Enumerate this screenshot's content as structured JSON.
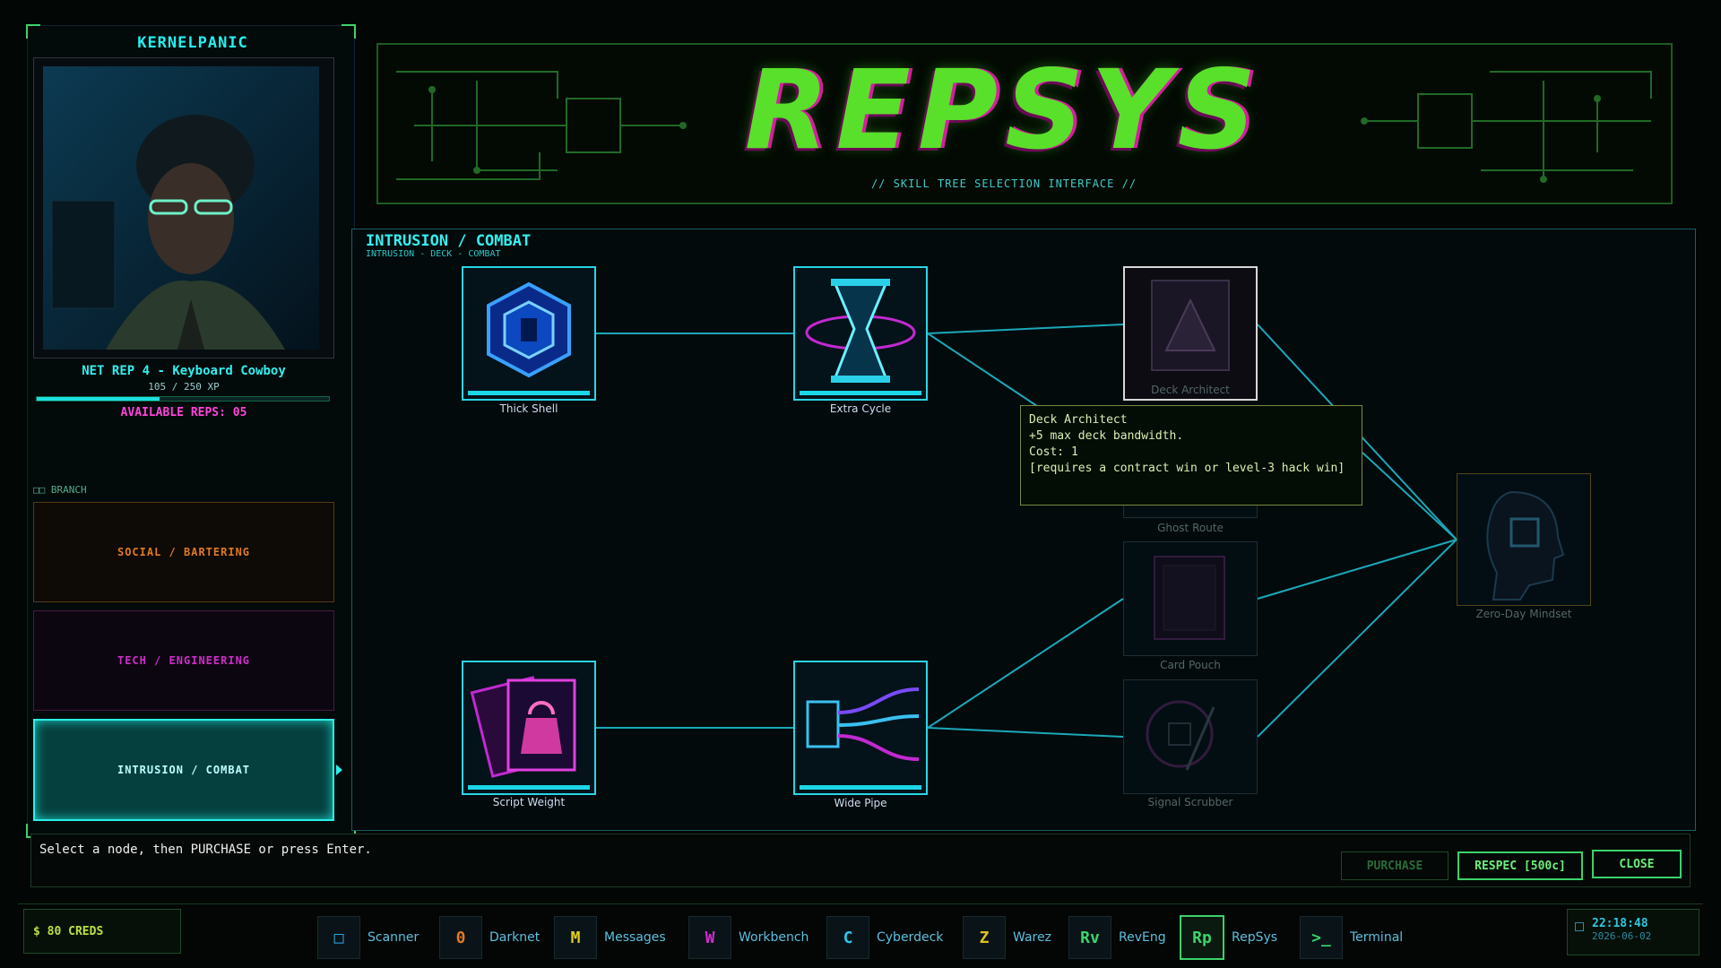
{
  "player": {
    "name": "KERNELPANIC",
    "rank": "NET REP 4 - Keyboard Cowboy",
    "xp": "105 / 250 XP",
    "xp_fraction": 0.42,
    "available_reps": "AVAILABLE REPS: 05"
  },
  "branches": {
    "label": "BRANCH",
    "items": [
      "SOCIAL / BARTERING",
      "TECH / ENGINEERING",
      "INTRUSION / COMBAT"
    ],
    "active": "INTRUSION / COMBAT"
  },
  "header": {
    "logo": "REPSYS",
    "subtitle": "//  SKILL TREE SELECTION INTERFACE  //"
  },
  "tree": {
    "title": "INTRUSION / COMBAT",
    "breadcrumb": "INTRUSION - DECK - COMBAT",
    "nodes": {
      "thick_shell": "Thick Shell",
      "extra_cycle": "Extra Cycle",
      "deck_architect": "Deck Architect",
      "ghost_route": "Ghost Route",
      "card_pouch": "Card Pouch",
      "signal_scrubber": "Signal Scrubber",
      "zero_day": "Zero-Day Mindset",
      "script_weight": "Script Weight",
      "wide_pipe": "Wide Pipe"
    }
  },
  "tooltip": {
    "title": "Deck Architect",
    "line1": "+5 max deck bandwidth.",
    "line2": "Cost: 1",
    "line3": "[requires a contract win or level-3 hack win]"
  },
  "status": {
    "hint": "Select a node, then PURCHASE or press Enter.",
    "purchase": "PURCHASE",
    "respec": "RESPEC [500c]",
    "close": "CLOSE"
  },
  "taskbar": {
    "credits": "$ 80 CREDS",
    "apps": [
      {
        "icon": "□",
        "label": "Scanner",
        "color": "#2aa8e8"
      },
      {
        "icon": "0",
        "label": "Darknet",
        "color": "#e07a20"
      },
      {
        "icon": "M",
        "label": "Messages",
        "color": "#e0d020"
      },
      {
        "icon": "W",
        "label": "Workbench",
        "color": "#d02ccc"
      },
      {
        "icon": "C",
        "label": "Cyberdeck",
        "color": "#2ac8e8"
      },
      {
        "icon": "Z",
        "label": "Warez",
        "color": "#e0c020"
      },
      {
        "icon": "Rv",
        "label": "RevEng",
        "color": "#3bd36a"
      },
      {
        "icon": "Rp",
        "label": "RepSys",
        "color": "#3bd36a"
      },
      {
        "icon": ">_",
        "label": "Terminal",
        "color": "#3bd36a"
      }
    ],
    "time": "22:18:48",
    "date": "2026-06-02"
  }
}
